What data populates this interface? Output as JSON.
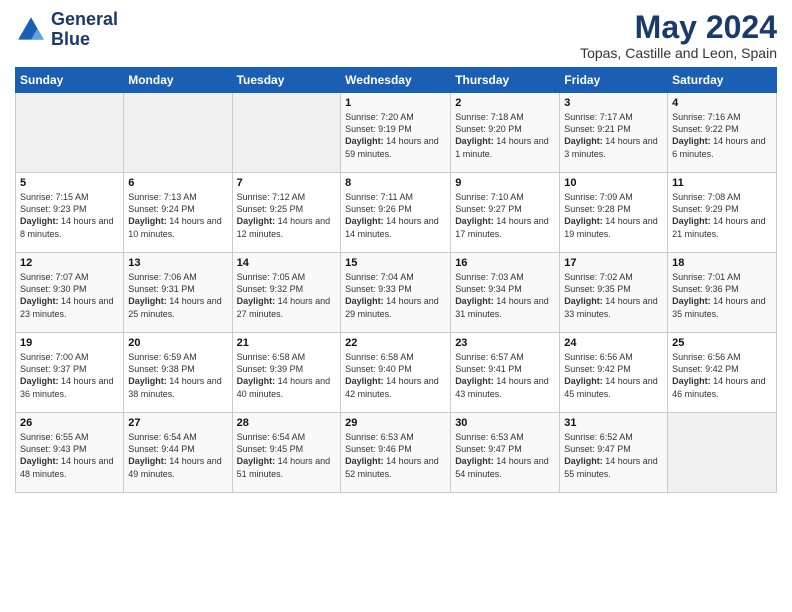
{
  "header": {
    "logo_line1": "General",
    "logo_line2": "Blue",
    "title": "May 2024",
    "subtitle": "Topas, Castille and Leon, Spain"
  },
  "weekdays": [
    "Sunday",
    "Monday",
    "Tuesday",
    "Wednesday",
    "Thursday",
    "Friday",
    "Saturday"
  ],
  "weeks": [
    [
      {
        "day": "",
        "info": ""
      },
      {
        "day": "",
        "info": ""
      },
      {
        "day": "",
        "info": ""
      },
      {
        "day": "1",
        "info": "Sunrise: 7:20 AM\nSunset: 9:19 PM\nDaylight: 14 hours and 59 minutes."
      },
      {
        "day": "2",
        "info": "Sunrise: 7:18 AM\nSunset: 9:20 PM\nDaylight: 14 hours and 1 minute."
      },
      {
        "day": "3",
        "info": "Sunrise: 7:17 AM\nSunset: 9:21 PM\nDaylight: 14 hours and 3 minutes."
      },
      {
        "day": "4",
        "info": "Sunrise: 7:16 AM\nSunset: 9:22 PM\nDaylight: 14 hours and 6 minutes."
      }
    ],
    [
      {
        "day": "5",
        "info": "Sunrise: 7:15 AM\nSunset: 9:23 PM\nDaylight: 14 hours and 8 minutes."
      },
      {
        "day": "6",
        "info": "Sunrise: 7:13 AM\nSunset: 9:24 PM\nDaylight: 14 hours and 10 minutes."
      },
      {
        "day": "7",
        "info": "Sunrise: 7:12 AM\nSunset: 9:25 PM\nDaylight: 14 hours and 12 minutes."
      },
      {
        "day": "8",
        "info": "Sunrise: 7:11 AM\nSunset: 9:26 PM\nDaylight: 14 hours and 14 minutes."
      },
      {
        "day": "9",
        "info": "Sunrise: 7:10 AM\nSunset: 9:27 PM\nDaylight: 14 hours and 17 minutes."
      },
      {
        "day": "10",
        "info": "Sunrise: 7:09 AM\nSunset: 9:28 PM\nDaylight: 14 hours and 19 minutes."
      },
      {
        "day": "11",
        "info": "Sunrise: 7:08 AM\nSunset: 9:29 PM\nDaylight: 14 hours and 21 minutes."
      }
    ],
    [
      {
        "day": "12",
        "info": "Sunrise: 7:07 AM\nSunset: 9:30 PM\nDaylight: 14 hours and 23 minutes."
      },
      {
        "day": "13",
        "info": "Sunrise: 7:06 AM\nSunset: 9:31 PM\nDaylight: 14 hours and 25 minutes."
      },
      {
        "day": "14",
        "info": "Sunrise: 7:05 AM\nSunset: 9:32 PM\nDaylight: 14 hours and 27 minutes."
      },
      {
        "day": "15",
        "info": "Sunrise: 7:04 AM\nSunset: 9:33 PM\nDaylight: 14 hours and 29 minutes."
      },
      {
        "day": "16",
        "info": "Sunrise: 7:03 AM\nSunset: 9:34 PM\nDaylight: 14 hours and 31 minutes."
      },
      {
        "day": "17",
        "info": "Sunrise: 7:02 AM\nSunset: 9:35 PM\nDaylight: 14 hours and 33 minutes."
      },
      {
        "day": "18",
        "info": "Sunrise: 7:01 AM\nSunset: 9:36 PM\nDaylight: 14 hours and 35 minutes."
      }
    ],
    [
      {
        "day": "19",
        "info": "Sunrise: 7:00 AM\nSunset: 9:37 PM\nDaylight: 14 hours and 36 minutes."
      },
      {
        "day": "20",
        "info": "Sunrise: 6:59 AM\nSunset: 9:38 PM\nDaylight: 14 hours and 38 minutes."
      },
      {
        "day": "21",
        "info": "Sunrise: 6:58 AM\nSunset: 9:39 PM\nDaylight: 14 hours and 40 minutes."
      },
      {
        "day": "22",
        "info": "Sunrise: 6:58 AM\nSunset: 9:40 PM\nDaylight: 14 hours and 42 minutes."
      },
      {
        "day": "23",
        "info": "Sunrise: 6:57 AM\nSunset: 9:41 PM\nDaylight: 14 hours and 43 minutes."
      },
      {
        "day": "24",
        "info": "Sunrise: 6:56 AM\nSunset: 9:42 PM\nDaylight: 14 hours and 45 minutes."
      },
      {
        "day": "25",
        "info": "Sunrise: 6:56 AM\nSunset: 9:42 PM\nDaylight: 14 hours and 46 minutes."
      }
    ],
    [
      {
        "day": "26",
        "info": "Sunrise: 6:55 AM\nSunset: 9:43 PM\nDaylight: 14 hours and 48 minutes."
      },
      {
        "day": "27",
        "info": "Sunrise: 6:54 AM\nSunset: 9:44 PM\nDaylight: 14 hours and 49 minutes."
      },
      {
        "day": "28",
        "info": "Sunrise: 6:54 AM\nSunset: 9:45 PM\nDaylight: 14 hours and 51 minutes."
      },
      {
        "day": "29",
        "info": "Sunrise: 6:53 AM\nSunset: 9:46 PM\nDaylight: 14 hours and 52 minutes."
      },
      {
        "day": "30",
        "info": "Sunrise: 6:53 AM\nSunset: 9:47 PM\nDaylight: 14 hours and 54 minutes."
      },
      {
        "day": "31",
        "info": "Sunrise: 6:52 AM\nSunset: 9:47 PM\nDaylight: 14 hours and 55 minutes."
      },
      {
        "day": "",
        "info": ""
      }
    ]
  ]
}
